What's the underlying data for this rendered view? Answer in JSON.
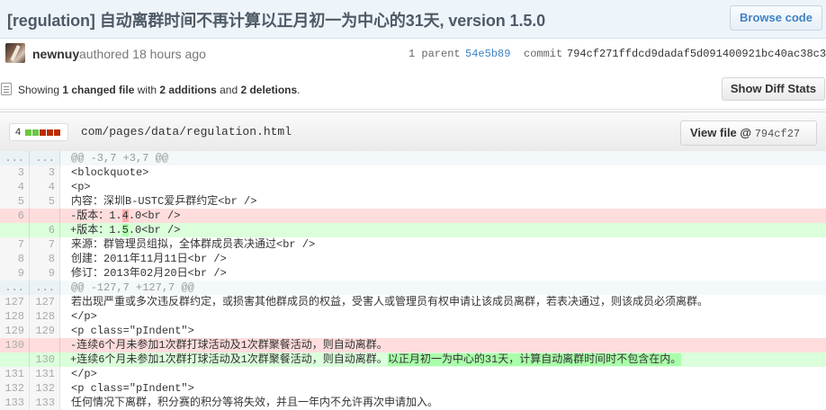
{
  "commit": {
    "title": "[regulation] 自动离群时间不再计算以正月初一为中心的31天, version 1.5.0",
    "browse_label": "Browse code",
    "author": "newnuy",
    "authored_text": "authored 18 hours ago",
    "parent_label": "1 parent",
    "parent_sha": "54e5b89",
    "commit_label": "commit",
    "commit_sha": "794cf271ffdcd9dadaf5d091400921bc40ac38c3"
  },
  "toc": {
    "prefix": "Showing ",
    "changed": "1 changed file",
    "mid1": " with ",
    "additions": "2 additions",
    "mid2": " and ",
    "deletions": "2 deletions",
    "suffix": ".",
    "diff_stats_button": "Show Diff Stats"
  },
  "file": {
    "diffstat_count": "4",
    "diffstat_blocks": [
      "#6cc644",
      "#6cc644",
      "#bd2c00",
      "#bd2c00",
      "#bd2c00"
    ],
    "path": "com/pages/data/regulation.html",
    "view_file_label": "View file @",
    "view_file_sha": "794cf27"
  },
  "diff_lines": [
    {
      "type": "hunk",
      "old": "...",
      "new": "...",
      "text": "@@ -3,7 +3,7 @@"
    },
    {
      "type": "ctx",
      "old": "3",
      "new": "3",
      "text": " <blockquote>"
    },
    {
      "type": "ctx",
      "old": "4",
      "new": "4",
      "text": " <p>"
    },
    {
      "type": "ctx",
      "old": "5",
      "new": "5",
      "text": " 内容：深圳B-USTC爱乒群约定<br />"
    },
    {
      "type": "del",
      "old": "6",
      "new": "",
      "pre": "-版本：1.",
      "hl": "4",
      "post": ".0<br />"
    },
    {
      "type": "add",
      "old": "",
      "new": "6",
      "pre": "+版本：1.",
      "hl": "5",
      "post": ".0<br />"
    },
    {
      "type": "ctx",
      "old": "7",
      "new": "7",
      "text": " 来源：群管理员组拟，全体群成员表决通过<br />"
    },
    {
      "type": "ctx",
      "old": "8",
      "new": "8",
      "text": " 创建：2011年11月11日<br />"
    },
    {
      "type": "ctx",
      "old": "9",
      "new": "9",
      "text": " 修订：2013年02月20日<br />"
    },
    {
      "type": "hunk",
      "old": "...",
      "new": "...",
      "text": "@@ -127,7 +127,7 @@"
    },
    {
      "type": "ctx",
      "old": "127",
      "new": "127",
      "text": " 若出现严重或多次违反群约定，或损害其他群成员的权益，受害人或管理员有权申请让该成员离群，若表决通过，则该成员必须离群。"
    },
    {
      "type": "ctx",
      "old": "128",
      "new": "128",
      "text": " </p>"
    },
    {
      "type": "ctx",
      "old": "129",
      "new": "129",
      "text": " <p class=\"pIndent\">"
    },
    {
      "type": "del",
      "old": "130",
      "new": "",
      "pre": "-连续6个月未参加1次群打球活动及1次群聚餐活动，则自动离群。",
      "hl": "",
      "post": ""
    },
    {
      "type": "add",
      "old": "",
      "new": "130",
      "pre": "+连续6个月未参加1次群打球活动及1次群聚餐活动，则自动离群。",
      "hl": "以正月初一为中心的31天，计算自动离群时间时不包含在内。",
      "post": ""
    },
    {
      "type": "ctx",
      "old": "131",
      "new": "131",
      "text": " </p>"
    },
    {
      "type": "ctx",
      "old": "132",
      "new": "132",
      "text": " <p class=\"pIndent\">"
    },
    {
      "type": "ctx",
      "old": "133",
      "new": "133",
      "text": " 任何情况下离群，积分赛的积分等将失效，并且一年内不允许再次申请加入。"
    }
  ]
}
